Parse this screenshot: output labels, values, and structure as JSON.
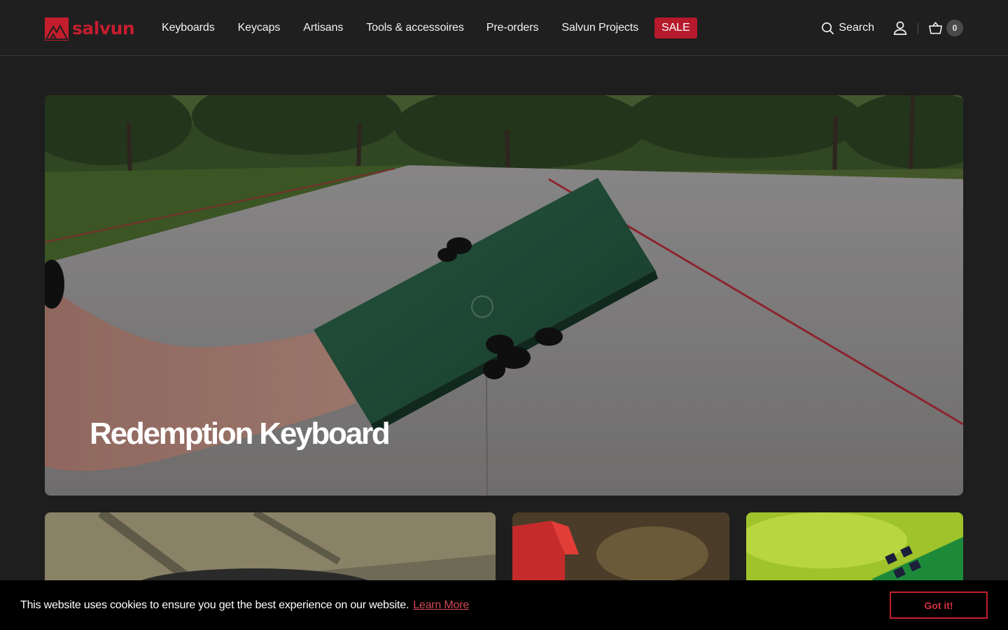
{
  "brand": {
    "name": "salvun",
    "accent": "#c41e2e"
  },
  "nav": {
    "items": [
      {
        "label": "Keyboards"
      },
      {
        "label": "Keycaps"
      },
      {
        "label": "Artisans"
      },
      {
        "label": "Tools & accessoires"
      },
      {
        "label": "Pre-orders"
      },
      {
        "label": "Salvun Projects"
      }
    ],
    "sale_label": "SALE"
  },
  "header_actions": {
    "search_label": "Search",
    "user_icon": "user-icon",
    "cart_icon": "basket-icon",
    "cart_count": "0"
  },
  "hero": {
    "title": "Redemption Keyboard"
  },
  "cookie": {
    "message": "This website uses cookies to ensure you get the best experience on our website.",
    "learn_more": "Learn More",
    "accept": "Got it!"
  }
}
